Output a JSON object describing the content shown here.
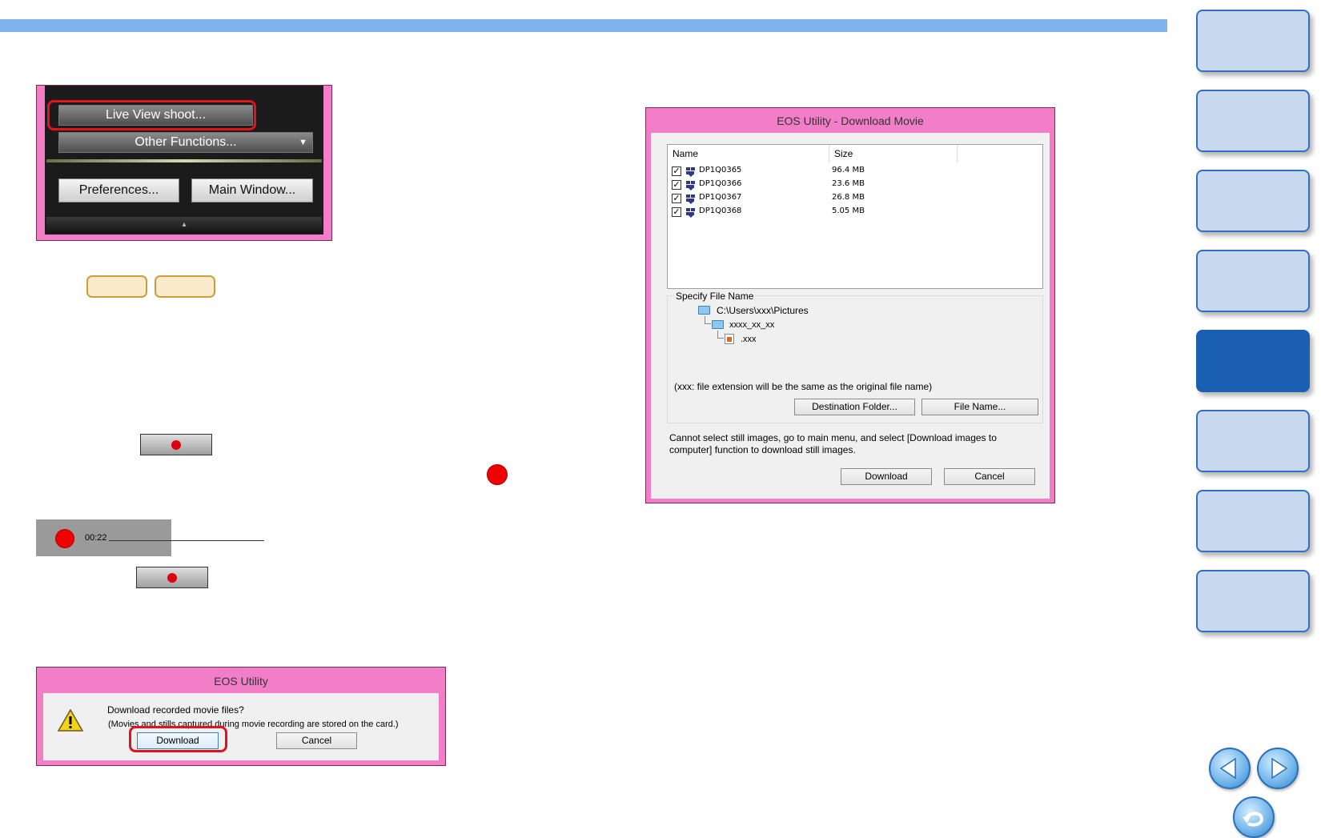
{
  "dark_panel": {
    "live_view_label": "Live View shoot...",
    "other_functions_label": "Other Functions...",
    "dropdown_arrow": "▼",
    "preferences_label": "Preferences...",
    "main_window_label": "Main Window...",
    "handle_glyph": "▴"
  },
  "status_bar": {
    "time": "00:22"
  },
  "confirm_dialog": {
    "title": "EOS Utility",
    "message": "Download recorded movie files?",
    "note": "(Movies and stills captured during movie recording are stored on the card.)",
    "download_label": "Download",
    "cancel_label": "Cancel"
  },
  "download_dialog": {
    "title": "EOS Utility - Download Movie",
    "columns": [
      "Name",
      "Size"
    ],
    "files": [
      {
        "name": "DP1Q0365",
        "size": "96.4  MB"
      },
      {
        "name": "DP1Q0366",
        "size": "23.6  MB"
      },
      {
        "name": "DP1Q0367",
        "size": "26.8  MB"
      },
      {
        "name": "DP1Q0368",
        "size": "5.05  MB"
      }
    ],
    "specify_label": "Specify File Name",
    "path_root": "C:\\Users\\xxx\\Pictures",
    "path_folder": "xxxx_xx_xx",
    "path_file": ".xxx",
    "extension_note": "(xxx: file extension will be the same as the original file name)",
    "destination_label": "Destination Folder...",
    "filename_label": "File Name...",
    "info_line1": "Cannot select still images, go to main menu, and select [Download images to",
    "info_line2": "computer] function to download still images.",
    "download_label": "Download",
    "cancel_label": "Cancel"
  },
  "nav": {
    "active_index": 4,
    "colors": {
      "accent": "#1b5fb2",
      "tab": "#c8d8ee",
      "pink": "#f27ec8",
      "record": "#e00010"
    }
  }
}
